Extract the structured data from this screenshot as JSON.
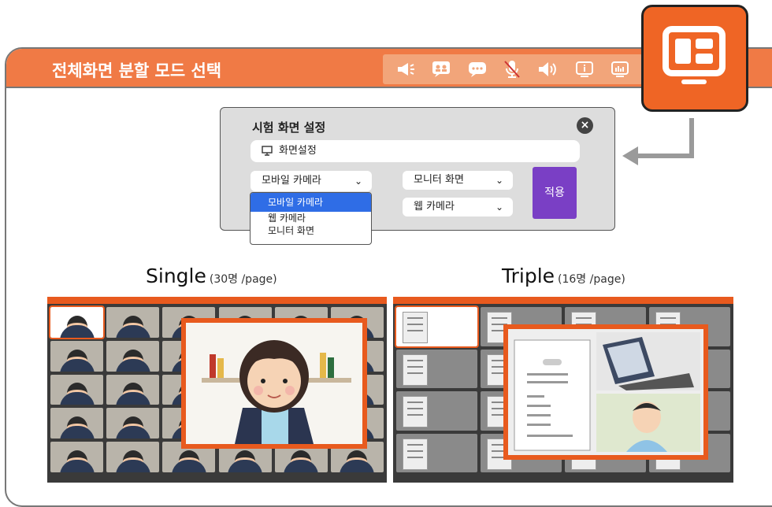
{
  "header": {
    "title": "전체화면 분할 모드 선택",
    "icons": [
      "megaphone-icon",
      "chat-people-icon",
      "speech-bubble-icon",
      "mic-off-icon",
      "speaker-icon",
      "info-icon",
      "chart-screen-icon"
    ]
  },
  "tv_icon": "split-screen-monitor-icon",
  "dialog": {
    "title": "시험 화면 설정",
    "close_label": "×",
    "screen_setting_label": "화면설정",
    "select_left_value": "모바일 카메라",
    "select_right_top_value": "모니터 화면",
    "select_right_bottom_value": "웹 카메라",
    "apply_label": "적용",
    "dropdown_options": [
      "모바일 카메라",
      "웹 카메라",
      "모니터 화면"
    ]
  },
  "single": {
    "name": "Single",
    "detail": "(30명 /page)"
  },
  "triple": {
    "name": "Triple",
    "detail": "(16명 /page)"
  },
  "colors": {
    "accent": "#f07a45",
    "border_orange": "#e85a1e",
    "apply_purple": "#7a3fc5",
    "dropdown_selected": "#2f6de6"
  }
}
